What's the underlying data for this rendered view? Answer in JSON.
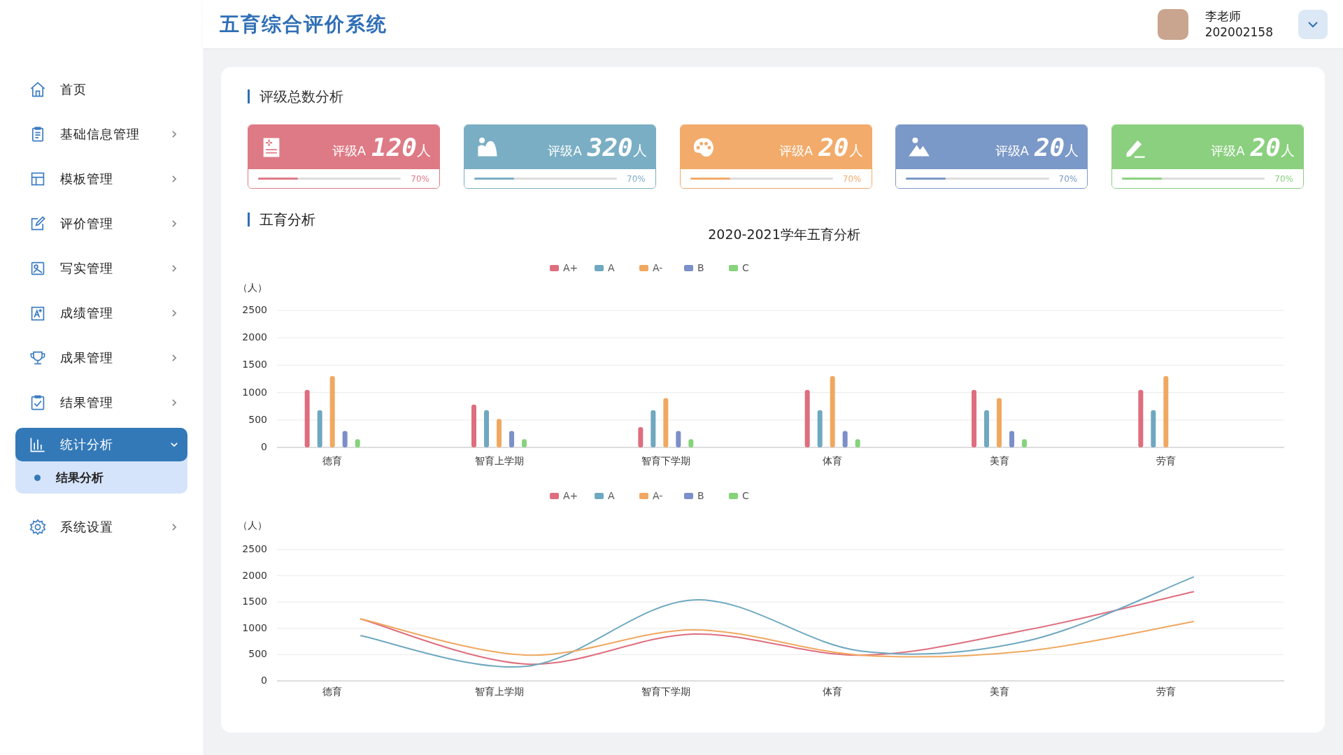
{
  "header": {
    "title": "五育综合评价系统",
    "user_name": "李老师",
    "user_id": "202002158"
  },
  "sidebar": {
    "items": [
      {
        "label": "首页",
        "kind": "link",
        "selected": false
      },
      {
        "label": "基础信息管理",
        "kind": "menu",
        "selected": false,
        "expanded": false
      },
      {
        "label": "模板管理",
        "kind": "menu",
        "selected": false,
        "expanded": false
      },
      {
        "label": "评价管理",
        "kind": "menu",
        "selected": false,
        "expanded": false
      },
      {
        "label": "写实管理",
        "kind": "menu",
        "selected": false,
        "expanded": false
      },
      {
        "label": "成绩管理",
        "kind": "menu",
        "selected": false,
        "expanded": false
      },
      {
        "label": "成果管理",
        "kind": "menu",
        "selected": false,
        "expanded": false
      },
      {
        "label": "结果管理",
        "kind": "menu",
        "selected": false,
        "expanded": false
      },
      {
        "label": "统计分析",
        "kind": "menu",
        "selected": true,
        "expanded": true,
        "children": [
          {
            "label": "结果分析",
            "selected": true
          }
        ]
      },
      {
        "label": "系统设置",
        "kind": "menu",
        "selected": false,
        "expanded": false
      }
    ]
  },
  "sections": [
    {
      "title": "评级总数分析"
    },
    {
      "title": "五育分析"
    }
  ],
  "stat_cards": [
    {
      "label": "评级A",
      "value": "120",
      "unit": "人",
      "level": 0.28,
      "percent": "70%",
      "color": "#de7a85"
    },
    {
      "label": "评级A",
      "value": "320",
      "unit": "人",
      "level": 0.28,
      "percent": "70%",
      "color": "#7aaec4"
    },
    {
      "label": "评级A",
      "value": "20",
      "unit": "人",
      "level": 0.28,
      "percent": "70%",
      "color": "#f2ab6a"
    },
    {
      "label": "评级A",
      "value": "20",
      "unit": "人",
      "level": 0.28,
      "percent": "70%",
      "color": "#7a98c8"
    },
    {
      "label": "评级A",
      "value": "20",
      "unit": "人",
      "level": 0.28,
      "percent": "70%",
      "color": "#8ad07f"
    }
  ],
  "charts": [
    {
      "chart_data": {
        "type": "bar",
        "title": "2020-2021学年五育分析",
        "ylabel": "（人）",
        "grid": true,
        "legend": "top",
        "categories": [
          "德育",
          "智育上学期",
          "智育下学期",
          "体育",
          "美育",
          "劳育"
        ],
        "ylim": [
          0,
          2500
        ],
        "yticks": [
          0,
          500,
          1000,
          1500,
          2000,
          2500
        ],
        "series": [
          {
            "name": "A+",
            "color": "#de6e7e",
            "values": [
              1050,
              780,
              370,
              1050,
              1050,
              1050
            ]
          },
          {
            "name": "A",
            "color": "#6fa8c0",
            "values": [
              680,
              680,
              680,
              680,
              680,
              680
            ]
          },
          {
            "name": "A-",
            "color": "#f0a860",
            "values": [
              1300,
              520,
              900,
              1300,
              900,
              1300
            ]
          },
          {
            "name": "B",
            "color": "#7b8fc8",
            "values": [
              300,
              300,
              300,
              300,
              300,
              null
            ]
          },
          {
            "name": "C",
            "color": "#86d37c",
            "values": [
              150,
              150,
              150,
              150,
              150,
              null
            ]
          }
        ]
      }
    },
    {
      "chart_data": {
        "type": "line",
        "ylabel": "（人）",
        "grid": true,
        "legend": "top",
        "categories": [
          "德育",
          "智育上学期",
          "智育下学期",
          "体育",
          "美育",
          "劳育"
        ],
        "ylim": [
          0,
          2500
        ],
        "yticks": [
          0,
          500,
          1000,
          1500,
          2000,
          2500
        ],
        "series": [
          {
            "name": "A+",
            "color": "#de6e7e",
            "values": [
              1180,
              320,
              890,
              490,
              970,
              1700
            ]
          },
          {
            "name": "A",
            "color": "#6fa8c0",
            "values": [
              860,
              280,
              1540,
              570,
              760,
              1980
            ]
          },
          {
            "name": "A-",
            "color": "#f0a860",
            "values": [
              1180,
              490,
              970,
              490,
              570,
              1130
            ]
          },
          {
            "name": "B",
            "color": "#7b8fc8",
            "values": [
              null,
              null,
              null,
              null,
              null,
              null
            ]
          },
          {
            "name": "C",
            "color": "#86d37c",
            "values": [
              null,
              null,
              null,
              null,
              null,
              null
            ]
          }
        ]
      }
    }
  ]
}
